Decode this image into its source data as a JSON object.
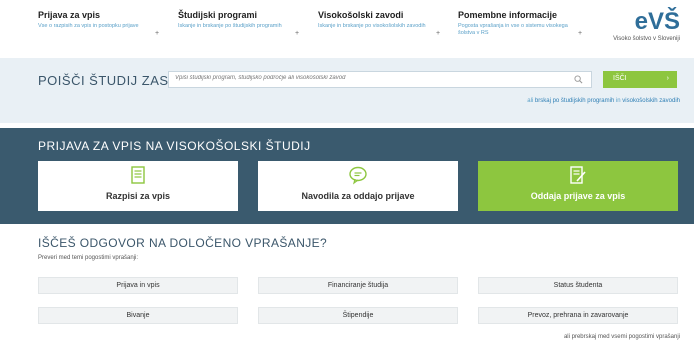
{
  "topnav": {
    "items": [
      {
        "title": "Prijava za vpis",
        "desc": "Vse o razpisih za vpis in postopku prijave"
      },
      {
        "title": "Študijski programi",
        "desc": "Iskanje in brskanje po študijskih programih"
      },
      {
        "title": "Visokošolski zavodi",
        "desc": "Iskanje in brskanje po visokošolskih zavodih"
      },
      {
        "title": "Pomembne informacije",
        "desc": "Pogosta vprašanja in vse o sistemu visokega šolstva v RS"
      }
    ],
    "arrow": "+",
    "logo": {
      "text": "eVŠ",
      "sub": "Visoko šolstvo v Sloveniji"
    }
  },
  "search": {
    "title": "POIŠČI ŠTUDIJ ZASE",
    "placeholder": "Vpiši študijski program, študijsko področje ali visokošolski zavod",
    "button_label": "IŠČI",
    "button_arrow": "›",
    "browse_prefix": "ali ",
    "browse_programs": "brskaj po študijskih programih",
    "browse_mid": " in ",
    "browse_institutions": "visokošolskih zavodih"
  },
  "application": {
    "title": "PRIJAVA ZA VPIS NA VISOKOŠOLSKI ŠTUDIJ",
    "cards": [
      {
        "label": "Razpisi za vpis",
        "icon": "document-icon"
      },
      {
        "label": "Navodila za oddajo prijave",
        "icon": "info-bubble-icon"
      },
      {
        "label": "Oddaja prijave za vpis",
        "icon": "edit-document-icon"
      }
    ]
  },
  "faq": {
    "title": "IŠČEŠ ODGOVOR NA DOLOČENO VPRAŠANJE?",
    "subtitle": "Preveri med temi pogostimi vprašanji:",
    "buttons": [
      "Prijava in vpis",
      "Financiranje študija",
      "Status študenta",
      "Bivanje",
      "Štipendije",
      "Prevoz, prehrana in zavarovanje"
    ],
    "more": "ali prebrskaj med vsemi pogostimi vprašanji"
  },
  "colors": {
    "accent_green": "#8dc63f",
    "band_dark": "#3a5a6e",
    "band_light": "#e9f0f5",
    "logo_blue": "#2f6e99"
  }
}
